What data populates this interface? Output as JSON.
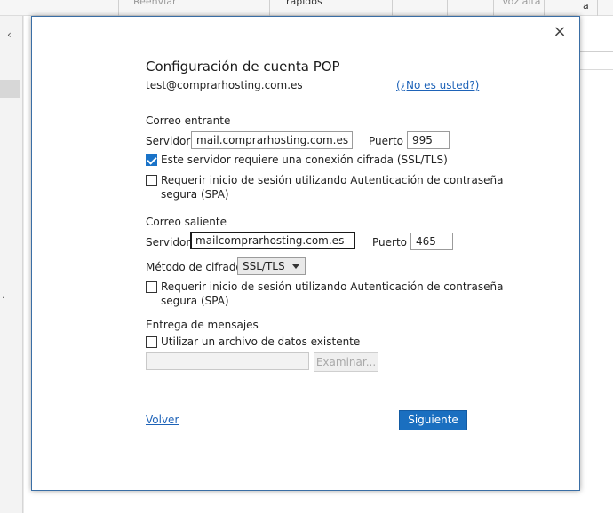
{
  "background": {
    "ribbon": {
      "reenviar_label": "Reenviar",
      "rapidos_label": "rápidos",
      "voz_alta_label": "Voz alta",
      "edge_label": "a"
    }
  },
  "dialog": {
    "title": "Configuración de cuenta POP",
    "email": "test@comprarhosting.com.es",
    "not_you_link": "(¿No es usted?)",
    "incoming": {
      "heading": "Correo entrante",
      "server_label": "Servidor",
      "server_value": "mail.comprarhosting.com.es",
      "port_label": "Puerto",
      "port_value": "995",
      "ssl_checkbox_label": "Este servidor requiere una conexión cifrada (SSL/TLS)",
      "ssl_checked": true,
      "spa_label_line1": "Requerir inicio de sesión utilizando Autenticación de contraseña",
      "spa_label_line2": "segura (SPA)",
      "spa_checked": false
    },
    "outgoing": {
      "heading": "Correo saliente",
      "server_label": "Servidor",
      "server_value": "mailcomprarhosting.com.es",
      "port_label": "Puerto",
      "port_value": "465",
      "encryption_label": "Método de cifrado",
      "encryption_value": "SSL/TLS",
      "spa_label_line1": "Requerir inicio de sesión utilizando Autenticación de contraseña",
      "spa_label_line2": "segura (SPA)",
      "spa_checked": false
    },
    "delivery": {
      "heading": "Entrega de mensajes",
      "existing_file_label": "Utilizar un archivo de datos existente",
      "existing_file_checked": false,
      "file_path_value": "",
      "browse_label": "Examinar..."
    },
    "back_link": "Volver",
    "next_button": "Siguiente",
    "close_icon": "×"
  }
}
